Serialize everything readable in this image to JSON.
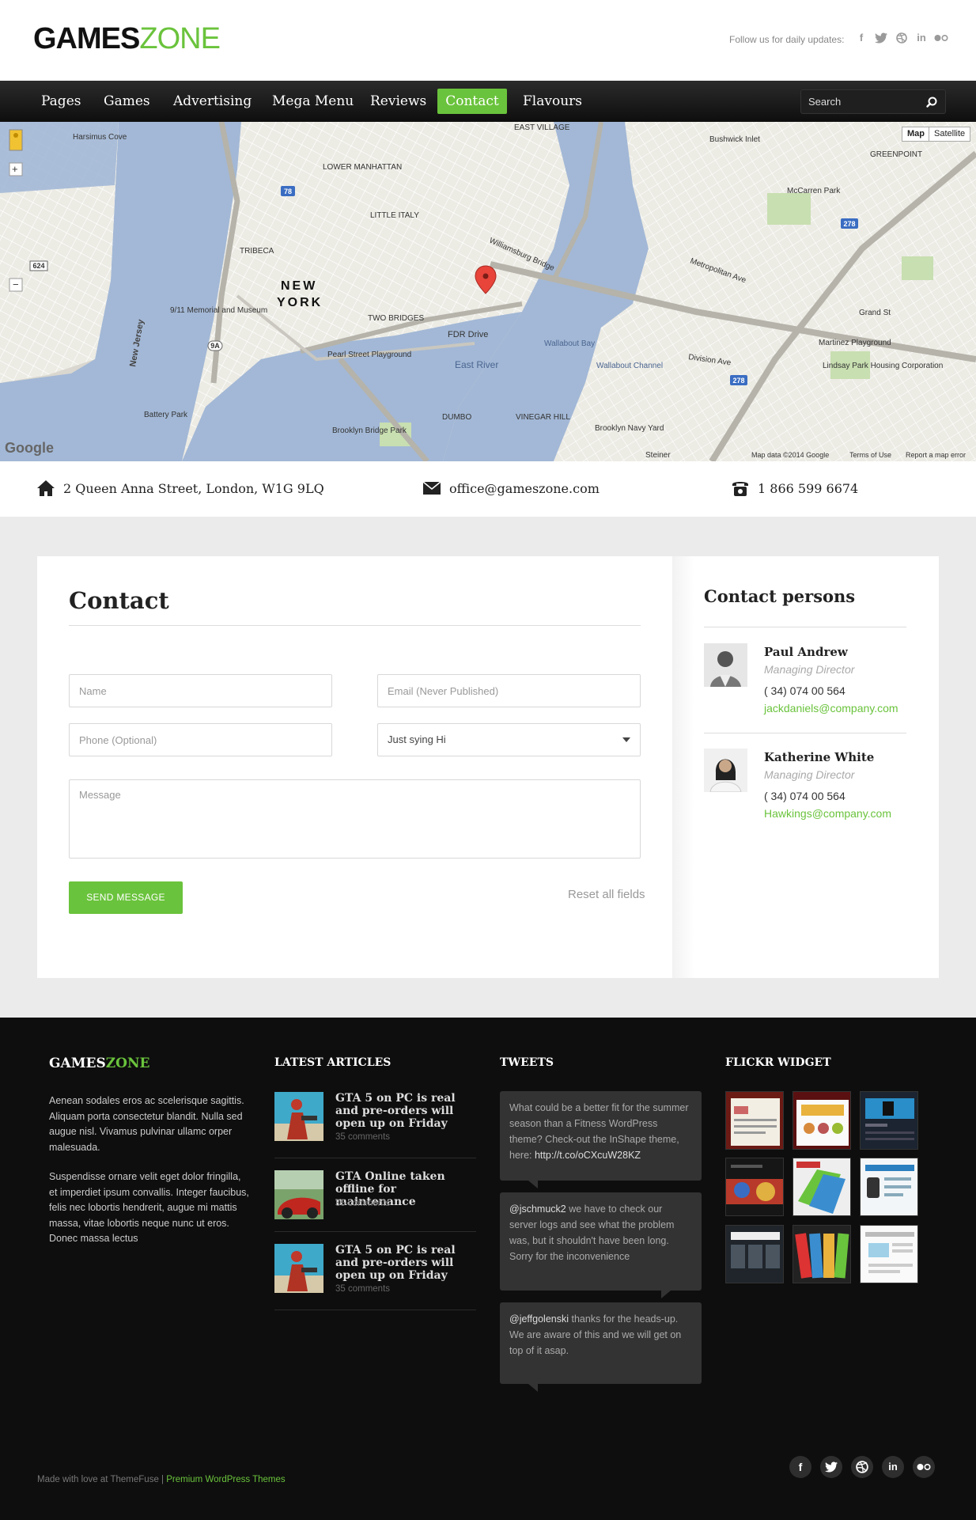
{
  "header": {
    "logo_part1": "GAMES",
    "logo_part2": "ZONE",
    "follow_text": "Follow us for daily updates:",
    "social_icons": [
      "facebook-icon",
      "twitter-icon",
      "dribbble-icon",
      "linkedin-icon",
      "flickr-icon"
    ]
  },
  "nav": {
    "items": [
      {
        "label": "Pages"
      },
      {
        "label": "Games"
      },
      {
        "label": "Advertising"
      },
      {
        "label": "Mega Menu"
      },
      {
        "label": "Reviews"
      },
      {
        "label": "Contact",
        "active": true
      },
      {
        "label": "Flavours"
      }
    ],
    "search_placeholder": "Search"
  },
  "map": {
    "map_button": "Map",
    "satellite_button": "Satellite",
    "city_line1": "NEW",
    "city_line2": "YORK",
    "labels": {
      "lower_manhattan": "LOWER MANHATTAN",
      "east_village": "EAST VILLAGE",
      "tribeca": "TRIBECA",
      "little_italy": "LITTLE ITALY",
      "two_bridges": "TWO BRIDGES",
      "memorial": "9/11 Memorial and Museum",
      "pearl_street": "Pearl Street Playground",
      "battery_park": "Battery Park",
      "dumbo": "DUMBO",
      "vinegar_hill": "VINEGAR HILL",
      "brooklyn_navy": "Brooklyn Navy Yard",
      "brooklyn_bridge_park": "Brooklyn Bridge Park",
      "wallabout_bay": "Wallabout Bay",
      "wallabout_channel": "Wallabout Channel",
      "east_river": "East River",
      "fdr_drive": "FDR Drive",
      "williamsburg_bridge": "Williamsburg Bridge",
      "metropolitan_ave": "Metropolitan Ave",
      "greenpoint": "GREENPOINT",
      "mccarren_park": "McCarren Park",
      "martinez_playground": "Martinez Playground",
      "lindsay_park": "Lindsay Park Housing Corporation",
      "new_jersey": "New Jersey",
      "harsimus_cove": "Harsimus Cove",
      "bushwick_inlet": "Bushwick Inlet",
      "division_ave": "Division Ave",
      "grand_st": "Grand St",
      "steiner": "Steiner"
    },
    "google": "Google",
    "map_data": "Map data ©2014 Google",
    "terms": "Terms of Use",
    "report": "Report a map error",
    "route_shields": [
      "78",
      "278",
      "278",
      "9A",
      "624"
    ]
  },
  "info": {
    "address": "2 Queen Anna Street, London, W1G 9LQ",
    "email": "office@gameszone.com",
    "phone": "1 866 599 6674"
  },
  "form": {
    "title": "Contact",
    "name_placeholder": "Name",
    "email_placeholder": "Email (Never Published)",
    "phone_placeholder": "Phone (Optional)",
    "subject_value": "Just sying Hi",
    "message_placeholder": "Message",
    "send_label": "Send Message",
    "reset_label": "Reset all fields"
  },
  "sidebar": {
    "title": "Contact persons",
    "persons": [
      {
        "name": "Paul Andrew",
        "role": "Managing Director",
        "phone": "( 34) 074 00 564",
        "email": "jackdaniels@company.com"
      },
      {
        "name": "Katherine White",
        "role": "Managing Director",
        "phone": "( 34) 074 00 564",
        "email": "Hawkings@company.com"
      }
    ]
  },
  "footer": {
    "logo_part1": "GAMES",
    "logo_part2": "ZONE",
    "para1": "Aenean sodales eros ac scelerisque sagittis. Aliquam porta consectetur blandit. Nulla sed augue nisl. Vivamus pulvinar ullamc orper malesuada.",
    "para2": "Suspendisse ornare velit eget dolor fringilla, et imperdiet ipsum convallis. Integer faucibus, felis nec lobortis hendrerit, augue mi mattis massa, vitae lobortis neque nunc ut eros. Donec massa lectus",
    "articles_title": "LATEST ARTICLES",
    "articles": [
      {
        "title": "GTA 5 on PC is real and pre-orders will open up on Friday",
        "meta": "35 comments"
      },
      {
        "title": "GTA Online taken offline for maintenance",
        "meta": "35 comments"
      },
      {
        "title": "GTA 5 on PC is real and pre-orders will open up on Friday",
        "meta": "35 comments"
      }
    ],
    "tweets_title": "TWEETS",
    "tweets": [
      {
        "handle": "",
        "text": "What could be a better fit for the summer season than a Fitness WordPress theme? Check-out the InShape theme, here: ",
        "link": "http://t.co/oCXcuW28KZ"
      },
      {
        "handle": "@jschmuck2",
        "text": " we have to check our server logs and see what the problem was, but it shouldn't have been long. Sorry for the inconvenience",
        "link": ""
      },
      {
        "handle": "@jeffgolenski",
        "text": " thanks for the heads-up. We are aware of this and we will get on top of it asap.",
        "link": ""
      }
    ],
    "flickr_title": "FLICKR WIDGET",
    "copyright": "Made with love at ThemeFuse",
    "separator": "|",
    "copyright_link": "Premium WordPress Themes",
    "social_icons": [
      "facebook-icon",
      "twitter-icon",
      "dribbble-icon",
      "linkedin-icon",
      "flickr-icon"
    ]
  },
  "colors": {
    "accent": "#6ac33c",
    "nav_bg": "#1a1a1a",
    "footer_bg": "#0e0e0e",
    "water": "#a3b8d6"
  }
}
